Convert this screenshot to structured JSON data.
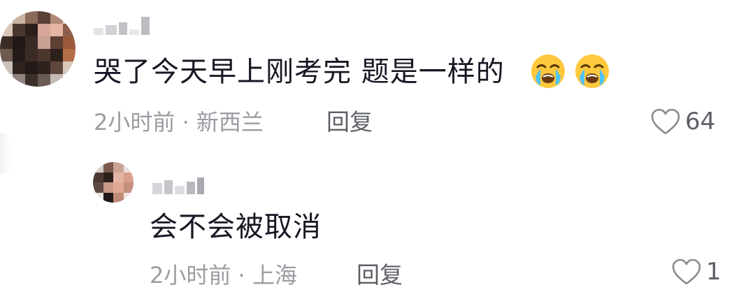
{
  "comments": [
    {
      "text": "哭了今天早上刚考完 题是一样的",
      "emojis": [
        "loudly-crying-face",
        "loudly-crying-face"
      ],
      "meta": "2小时前 · 新西兰",
      "reply_label": "回复",
      "likes": "64",
      "reply": {
        "text": "会不会被取消",
        "meta": "2小时前 · 上海",
        "reply_label": "回复",
        "likes": "1"
      }
    }
  ],
  "icons": {
    "like": "heart-outline-icon",
    "emoji": "loudly-crying-face-emoji"
  },
  "colors": {
    "text_primary": "#161823",
    "text_secondary": "#9b9ca2",
    "action": "#5e6068",
    "emoji_face": "#ffc83d",
    "emoji_tears": "#4fc3f7"
  }
}
